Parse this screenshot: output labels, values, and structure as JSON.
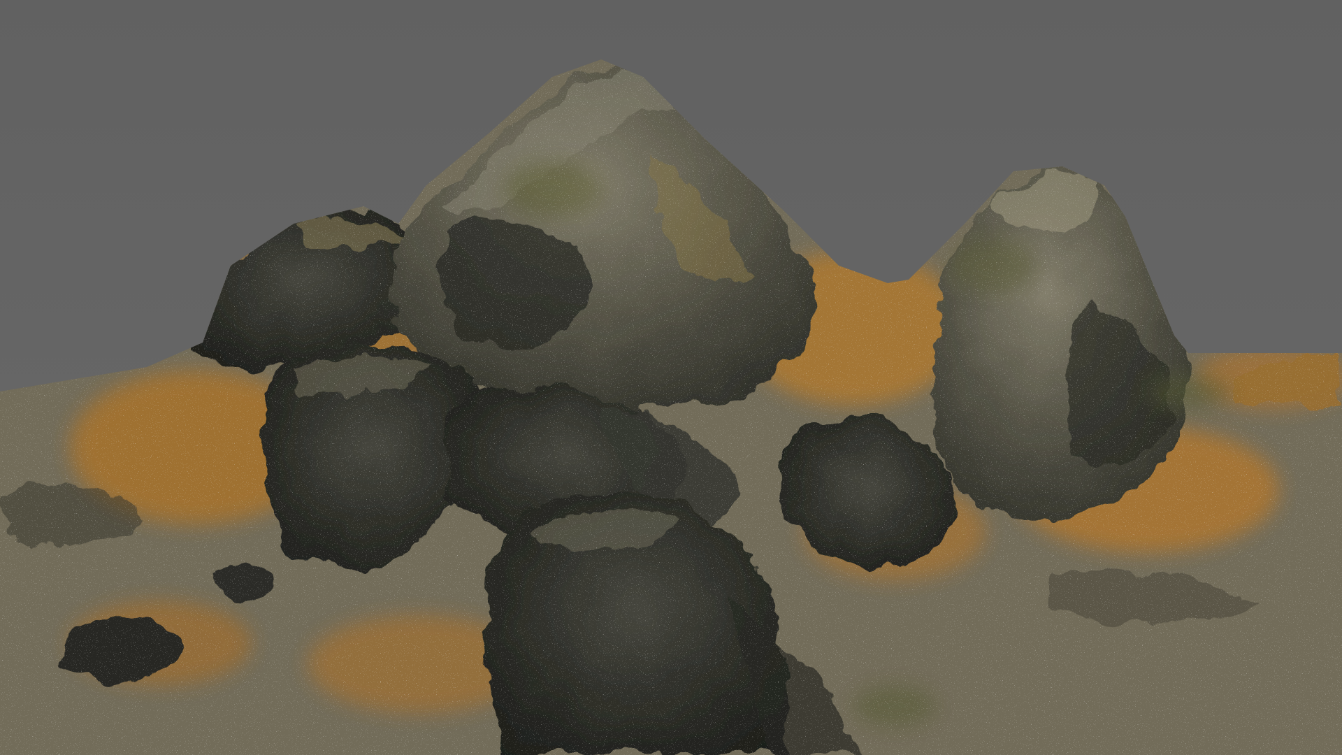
{
  "viewport": {
    "background_color": "#666666"
  },
  "scene": {
    "subject": "rock-formation-render",
    "palette": {
      "dark_rock": "#2b2c26",
      "mid_rock": "#4a4b3f",
      "light_rock": "#7d7a66",
      "ochre_soil": "#b37a2e",
      "ochre_light": "#c99246",
      "moss": "#5c5e35",
      "ground": "#8a8370",
      "speckle": "#e8e6dc"
    }
  }
}
